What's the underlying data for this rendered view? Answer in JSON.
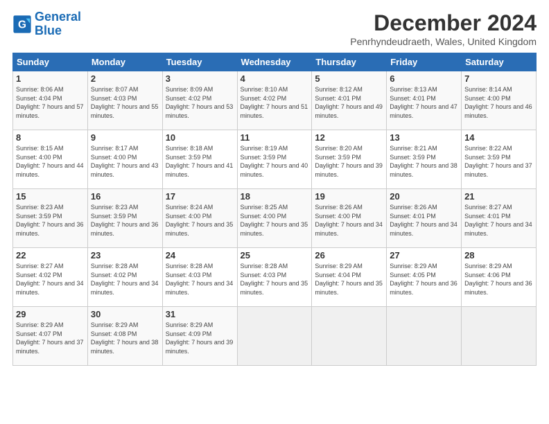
{
  "logo": {
    "line1": "General",
    "line2": "Blue"
  },
  "title": "December 2024",
  "subtitle": "Penrhyndeudraeth, Wales, United Kingdom",
  "headers": [
    "Sunday",
    "Monday",
    "Tuesday",
    "Wednesday",
    "Thursday",
    "Friday",
    "Saturday"
  ],
  "weeks": [
    [
      {
        "day": "1",
        "sunrise": "8:06 AM",
        "sunset": "4:04 PM",
        "daylight": "7 hours and 57 minutes."
      },
      {
        "day": "2",
        "sunrise": "8:07 AM",
        "sunset": "4:03 PM",
        "daylight": "7 hours and 55 minutes."
      },
      {
        "day": "3",
        "sunrise": "8:09 AM",
        "sunset": "4:02 PM",
        "daylight": "7 hours and 53 minutes."
      },
      {
        "day": "4",
        "sunrise": "8:10 AM",
        "sunset": "4:02 PM",
        "daylight": "7 hours and 51 minutes."
      },
      {
        "day": "5",
        "sunrise": "8:12 AM",
        "sunset": "4:01 PM",
        "daylight": "7 hours and 49 minutes."
      },
      {
        "day": "6",
        "sunrise": "8:13 AM",
        "sunset": "4:01 PM",
        "daylight": "7 hours and 47 minutes."
      },
      {
        "day": "7",
        "sunrise": "8:14 AM",
        "sunset": "4:00 PM",
        "daylight": "7 hours and 46 minutes."
      }
    ],
    [
      {
        "day": "8",
        "sunrise": "8:15 AM",
        "sunset": "4:00 PM",
        "daylight": "7 hours and 44 minutes."
      },
      {
        "day": "9",
        "sunrise": "8:17 AM",
        "sunset": "4:00 PM",
        "daylight": "7 hours and 43 minutes."
      },
      {
        "day": "10",
        "sunrise": "8:18 AM",
        "sunset": "3:59 PM",
        "daylight": "7 hours and 41 minutes."
      },
      {
        "day": "11",
        "sunrise": "8:19 AM",
        "sunset": "3:59 PM",
        "daylight": "7 hours and 40 minutes."
      },
      {
        "day": "12",
        "sunrise": "8:20 AM",
        "sunset": "3:59 PM",
        "daylight": "7 hours and 39 minutes."
      },
      {
        "day": "13",
        "sunrise": "8:21 AM",
        "sunset": "3:59 PM",
        "daylight": "7 hours and 38 minutes."
      },
      {
        "day": "14",
        "sunrise": "8:22 AM",
        "sunset": "3:59 PM",
        "daylight": "7 hours and 37 minutes."
      }
    ],
    [
      {
        "day": "15",
        "sunrise": "8:23 AM",
        "sunset": "3:59 PM",
        "daylight": "7 hours and 36 minutes."
      },
      {
        "day": "16",
        "sunrise": "8:23 AM",
        "sunset": "3:59 PM",
        "daylight": "7 hours and 36 minutes."
      },
      {
        "day": "17",
        "sunrise": "8:24 AM",
        "sunset": "4:00 PM",
        "daylight": "7 hours and 35 minutes."
      },
      {
        "day": "18",
        "sunrise": "8:25 AM",
        "sunset": "4:00 PM",
        "daylight": "7 hours and 35 minutes."
      },
      {
        "day": "19",
        "sunrise": "8:26 AM",
        "sunset": "4:00 PM",
        "daylight": "7 hours and 34 minutes."
      },
      {
        "day": "20",
        "sunrise": "8:26 AM",
        "sunset": "4:01 PM",
        "daylight": "7 hours and 34 minutes."
      },
      {
        "day": "21",
        "sunrise": "8:27 AM",
        "sunset": "4:01 PM",
        "daylight": "7 hours and 34 minutes."
      }
    ],
    [
      {
        "day": "22",
        "sunrise": "8:27 AM",
        "sunset": "4:02 PM",
        "daylight": "7 hours and 34 minutes."
      },
      {
        "day": "23",
        "sunrise": "8:28 AM",
        "sunset": "4:02 PM",
        "daylight": "7 hours and 34 minutes."
      },
      {
        "day": "24",
        "sunrise": "8:28 AM",
        "sunset": "4:03 PM",
        "daylight": "7 hours and 34 minutes."
      },
      {
        "day": "25",
        "sunrise": "8:28 AM",
        "sunset": "4:03 PM",
        "daylight": "7 hours and 35 minutes."
      },
      {
        "day": "26",
        "sunrise": "8:29 AM",
        "sunset": "4:04 PM",
        "daylight": "7 hours and 35 minutes."
      },
      {
        "day": "27",
        "sunrise": "8:29 AM",
        "sunset": "4:05 PM",
        "daylight": "7 hours and 36 minutes."
      },
      {
        "day": "28",
        "sunrise": "8:29 AM",
        "sunset": "4:06 PM",
        "daylight": "7 hours and 36 minutes."
      }
    ],
    [
      {
        "day": "29",
        "sunrise": "8:29 AM",
        "sunset": "4:07 PM",
        "daylight": "7 hours and 37 minutes."
      },
      {
        "day": "30",
        "sunrise": "8:29 AM",
        "sunset": "4:08 PM",
        "daylight": "7 hours and 38 minutes."
      },
      {
        "day": "31",
        "sunrise": "8:29 AM",
        "sunset": "4:09 PM",
        "daylight": "7 hours and 39 minutes."
      },
      null,
      null,
      null,
      null
    ]
  ]
}
